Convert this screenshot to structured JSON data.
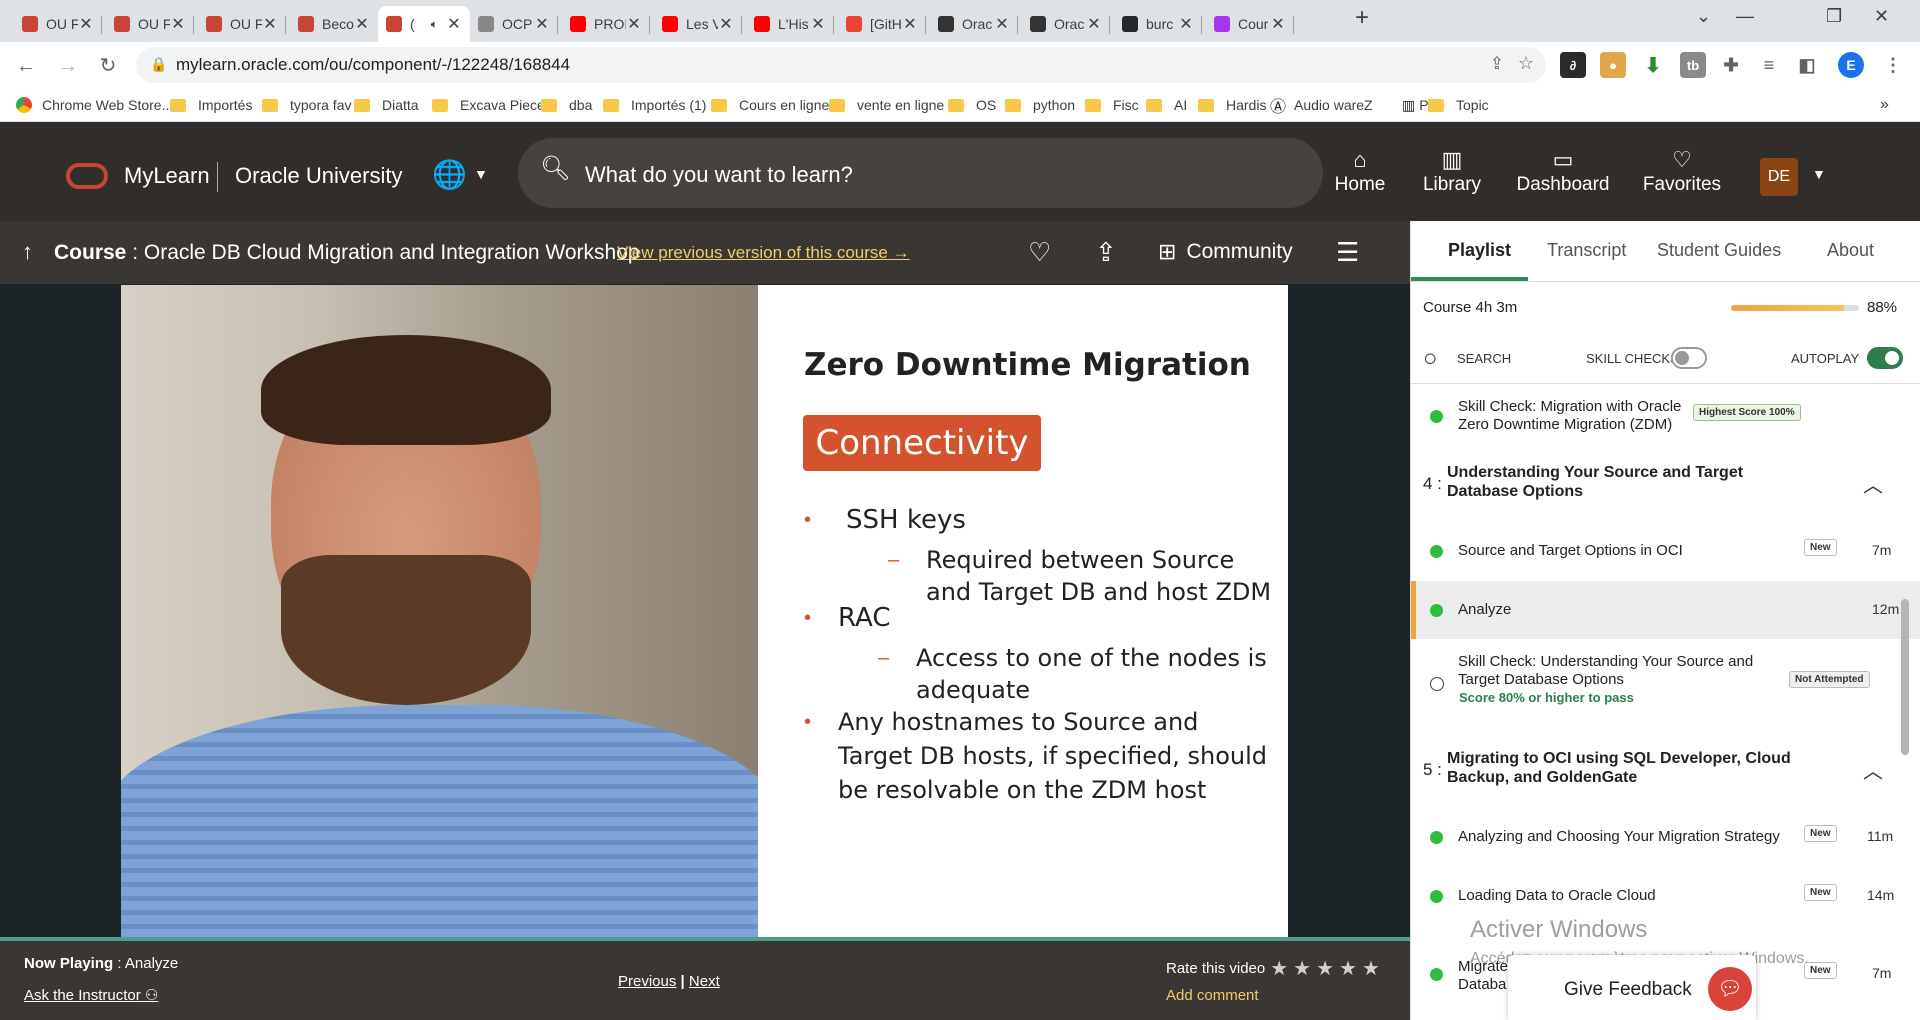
{
  "browser": {
    "tabs": [
      {
        "label": "OU F",
        "icon": "oracle-icon",
        "color": "#c74634"
      },
      {
        "label": "OU F",
        "icon": "oracle-icon",
        "color": "#c74634"
      },
      {
        "label": "OU F",
        "icon": "oracle-icon",
        "color": "#c74634"
      },
      {
        "label": "Beco",
        "icon": "oracle-ring-icon",
        "color": "#c74634"
      },
      {
        "label": "(",
        "icon": "oracle-ring-icon",
        "color": "#c74634"
      },
      {
        "label": "OCP",
        "icon": "page-icon",
        "color": "#888888"
      },
      {
        "label": "PROI",
        "icon": "youtube-icon",
        "color": "#ff0000"
      },
      {
        "label": "Les V",
        "icon": "youtube-icon",
        "color": "#ff0000"
      },
      {
        "label": "L'His",
        "icon": "youtube-icon",
        "color": "#ff0000"
      },
      {
        "label": "[GitH",
        "icon": "gmail-icon",
        "color": "#ea4335"
      },
      {
        "label": "Orac",
        "icon": "oracle-t-icon",
        "color": "#333333"
      },
      {
        "label": "Orac",
        "icon": "oracle-t-icon",
        "color": "#333333"
      },
      {
        "label": "burc",
        "icon": "github-icon",
        "color": "#24292e"
      },
      {
        "label": "Cour",
        "icon": "udemy-icon",
        "color": "#a435f0"
      }
    ],
    "url": "mylearn.oracle.com/ou/component/-/122248/168844",
    "avatar_letter": "E",
    "bookmarks": [
      {
        "label": "Chrome Web Store...",
        "icon": "chrome-store-icon"
      },
      {
        "label": "Importés",
        "icon": "folder-icon"
      },
      {
        "label": "typora fav",
        "icon": "folder-icon"
      },
      {
        "label": "Diatta",
        "icon": "folder-icon"
      },
      {
        "label": "Excava Piece",
        "icon": "folder-icon"
      },
      {
        "label": "dba",
        "icon": "folder-icon"
      },
      {
        "label": "Importés (1)",
        "icon": "folder-icon"
      },
      {
        "label": "Cours en ligne",
        "icon": "folder-icon"
      },
      {
        "label": "vente en ligne",
        "icon": "folder-icon"
      },
      {
        "label": "OS",
        "icon": "folder-icon"
      },
      {
        "label": "python",
        "icon": "folder-icon"
      },
      {
        "label": "Fisc",
        "icon": "folder-icon"
      },
      {
        "label": "AI",
        "icon": "folder-icon"
      },
      {
        "label": "Hardis",
        "icon": "folder-icon"
      },
      {
        "label": "Audio wareZ",
        "icon": "audio-icon"
      },
      {
        "label": "Pr...",
        "icon": "piano-icon"
      },
      {
        "label": "Topic",
        "icon": "folder-icon"
      }
    ]
  },
  "header": {
    "brand": "MyLearn",
    "org": "Oracle University",
    "search_placeholder": "What do you want to learn?",
    "nav": [
      {
        "label": "Home",
        "icon": "home-icon"
      },
      {
        "label": "Library",
        "icon": "library-icon"
      },
      {
        "label": "Dashboard",
        "icon": "dashboard-icon"
      },
      {
        "label": "Favorites",
        "icon": "heart-icon"
      }
    ],
    "avatar": "DE"
  },
  "course": {
    "prefix": "Course",
    "title": "Oracle DB Cloud Migration and Integration Workshop",
    "prev_version": "View previous version of this course",
    "community": "Community"
  },
  "slide": {
    "title": "Zero Downtime Migration",
    "chip": "Connectivity",
    "lines": {
      "b1": "SSH keys",
      "b1s1a": "Required between Source",
      "b1s1b": "and Target DB and host ZDM",
      "b2": "RAC",
      "b2s1a": "Access to one of the nodes is",
      "b2s1b": "adequate",
      "b3a": "Any hostnames to Source and",
      "b3b": "Target DB hosts, if specified, should",
      "b3c": "be resolvable on the ZDM host"
    }
  },
  "player": {
    "now_playing_label": "Now Playing",
    "now_playing_value": "Analyze",
    "ask": "Ask the Instructor",
    "previous": "Previous",
    "sep": "|",
    "next": "Next",
    "rate": "Rate this video",
    "rating": 0,
    "add_comment": "Add comment"
  },
  "panel": {
    "tabs": [
      "Playlist",
      "Transcript",
      "Student Guides",
      "About"
    ],
    "course_label": "Course",
    "course_duration": "4h 3m",
    "progress_pct": "88%",
    "progress": 0.88,
    "search": "SEARCH",
    "skill_checks": "SKILL CHECKS",
    "skill_checks_on": false,
    "autoplay": "AUTOPLAY",
    "autoplay_on": true,
    "items": [
      {
        "title": "Skill Check: Migration with Oracle Zero Downtime Migration (ZDM)",
        "badge": "Highest Score 100%",
        "status": "done"
      },
      {
        "title": "Source and Target Options in OCI",
        "badge": "New",
        "duration": "7m",
        "status": "done"
      },
      {
        "title": "Analyze",
        "duration": "12m",
        "status": "done",
        "current": true
      },
      {
        "title": "Skill Check: Understanding Your Source and Target Database Options",
        "badge": "Not Attempted",
        "note": "Score 80% or higher to pass",
        "status": "todo"
      },
      {
        "title": "Analyzing and Choosing Your Migration Strategy",
        "badge": "New",
        "duration": "11m",
        "status": "done"
      },
      {
        "title": "Loading Data to Oracle Cloud",
        "badge": "New",
        "duration": "14m",
        "status": "done"
      },
      {
        "title": "Migrate",
        "title2": "Databa",
        "badge": "New",
        "duration": "7m",
        "status": "done"
      }
    ],
    "sections": [
      {
        "num": "4 :",
        "title": "Understanding Your Source and Target Database Options"
      },
      {
        "num": "5 :",
        "title": "Migrating to OCI using SQL Developer, Cloud Backup, and GoldenGate"
      }
    ]
  },
  "overlay": {
    "activate_title": "Activer Windows",
    "activate_sub": "Accédez aux paramètres pour activer Windows.",
    "feedback": "Give Feedback"
  },
  "colors": {
    "oracle_red": "#c74634",
    "accent_green": "#2e7d4f",
    "dot_green": "#2ebd3c",
    "link_gold": "#f0cc71"
  }
}
